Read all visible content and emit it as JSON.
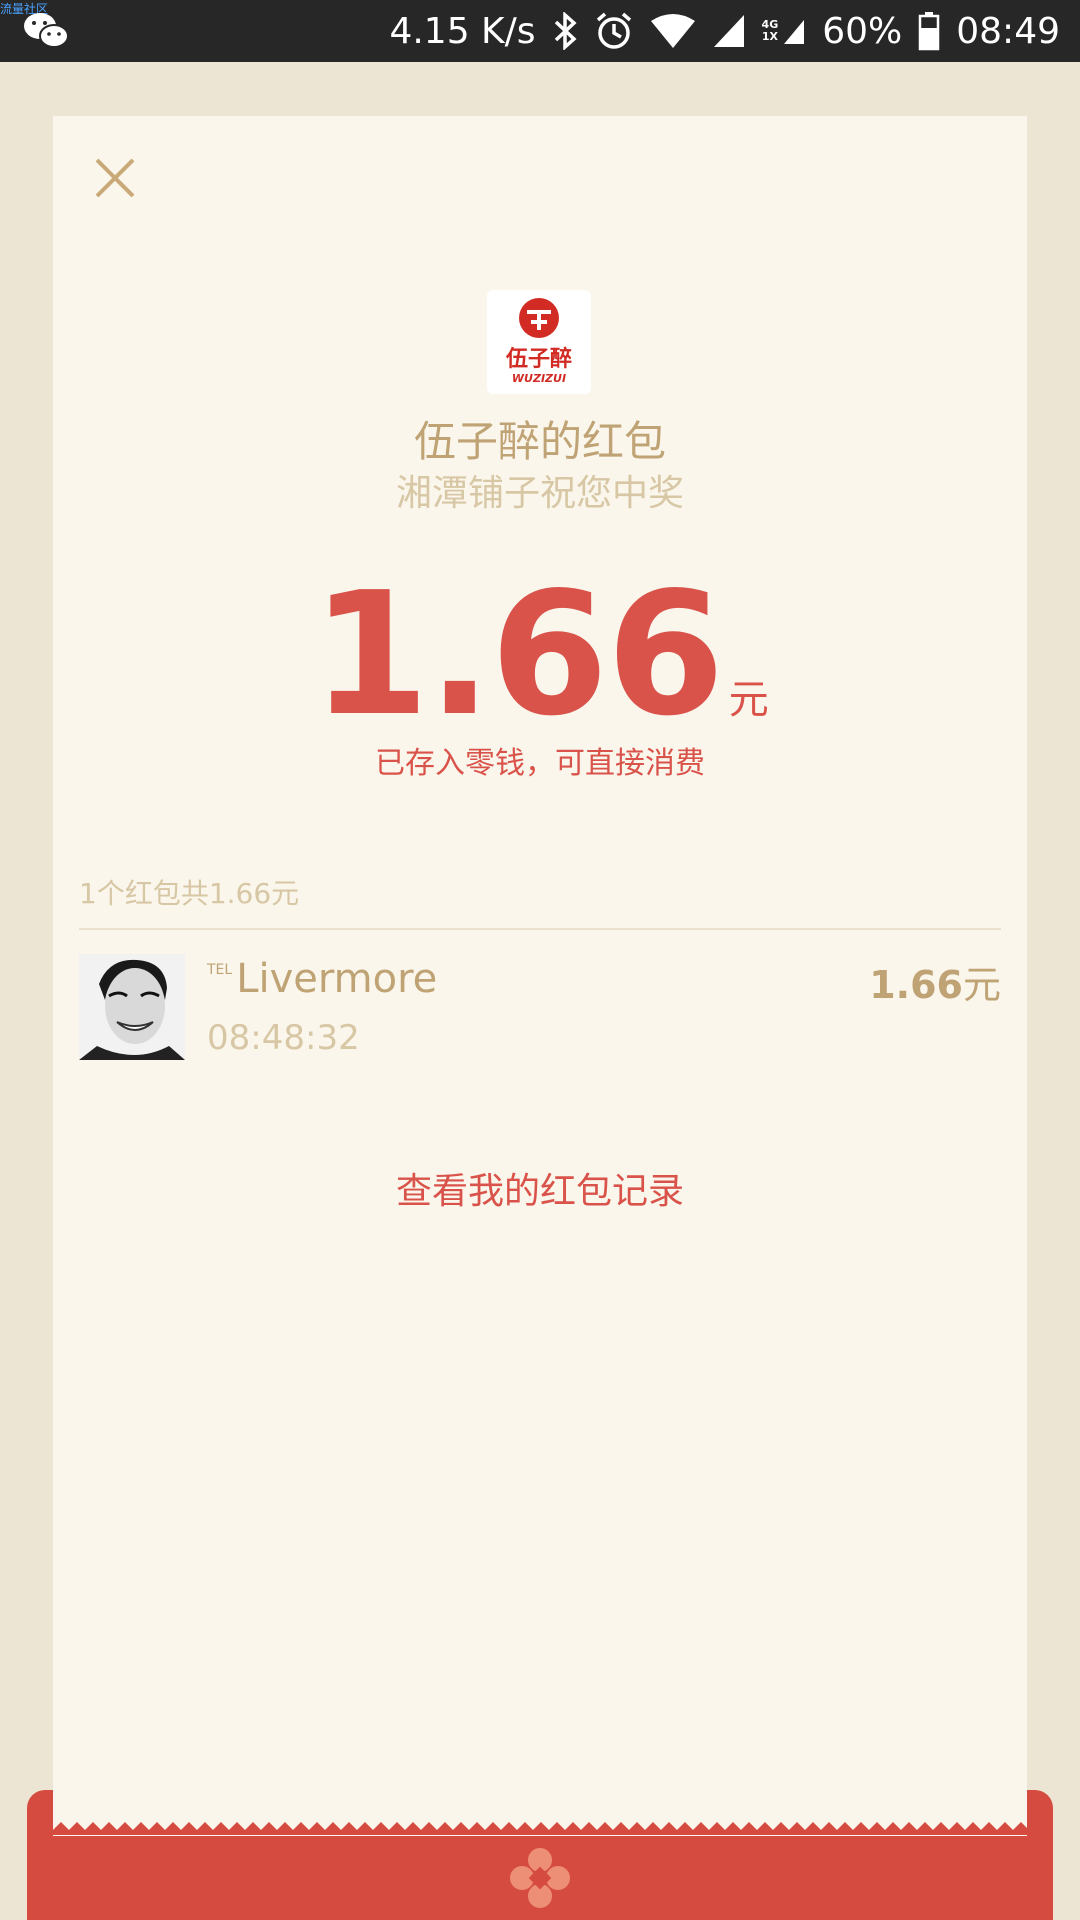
{
  "status_bar": {
    "watermark": "流量社区",
    "net_speed": "4.15 K/s",
    "network_top": "4G",
    "network_bottom": "1X",
    "battery": "60%",
    "time": "08:49"
  },
  "red_packet": {
    "logo_text": "伍子醉",
    "logo_subtext": "WUZIZUI",
    "sender_title": "伍子醉的红包",
    "blessing": "湘潭铺子祝您中奖",
    "amount": "1.66",
    "amount_unit": "元",
    "stored_note": "已存入零钱，可直接消费"
  },
  "summary": "1个红包共1.66元",
  "records": [
    {
      "name_tag": "TEL",
      "name": "Livermore",
      "time": "08:48:32",
      "amount": "1.66",
      "unit": "元"
    }
  ],
  "history_link": "查看我的红包记录",
  "colors": {
    "accent_red": "#d9534a",
    "gold": "#bfa374",
    "light_gold": "#d8c7a4",
    "card_bg": "#faf6ec",
    "page_bg": "#ece5d4",
    "status_bar": "#272727"
  },
  "icons": [
    "wechat-icon",
    "bluetooth-icon",
    "alarm-icon",
    "wifi-icon",
    "signal-icon",
    "battery-icon",
    "close-icon",
    "packet-emblem-icon"
  ]
}
